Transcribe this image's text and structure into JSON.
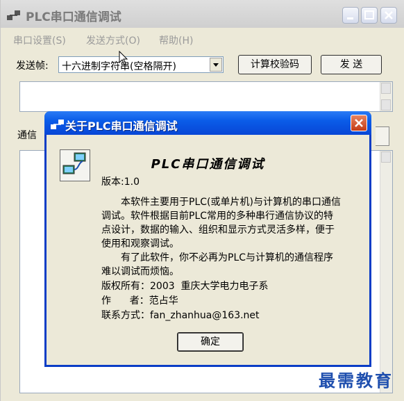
{
  "main_window": {
    "title": "PLC串口通信调试",
    "menu": [
      "串口设置(S)",
      "发送方式(O)",
      "帮助(H)"
    ],
    "send_frame_label": "发送帧:",
    "send_mode_value": "十六进制字符串(空格隔开)",
    "checksum_button": "计算校验码",
    "send_button": "发 送",
    "comm_label": "通信"
  },
  "about_dialog": {
    "title": "关于PLC串口通信调试",
    "heading": "PLC串口通信调试",
    "version": "版本:1.0",
    "description_1": "本软件主要用于PLC(或单片机)与计算机的串口通信调试。软件根据目前PLC常用的多种串行通信协议的特点设计，数据的输入、组织和显示方式灵活多样，便于使用和观察调试。",
    "description_2": "有了此软件，你不必再为PLC与计算机的通信程序难以调试而烦恼。",
    "copyright_label": "版权所有：",
    "copyright_value": "2003  重庆大学电力电子系",
    "author_label": "作      者：",
    "author_value": "范占华",
    "contact_label": "联系方式：",
    "contact_value": "fan_zhanhua@163.net",
    "ok_button": "确定"
  },
  "watermark": "最需教育",
  "colors": {
    "dialog_title_blue": "#0a5ce8",
    "close_red": "#c43b16",
    "watermark_blue": "#1f4fae"
  }
}
